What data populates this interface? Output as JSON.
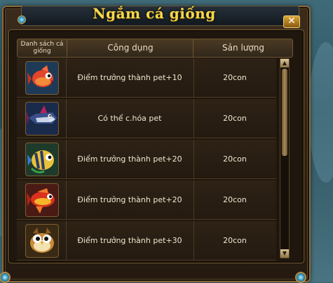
{
  "window": {
    "title": "Ngắm cá giống",
    "close_label": "✕"
  },
  "table": {
    "headers": {
      "list": "Danh sách cá giống",
      "use": "Công dụng",
      "qty": "Sản lượng"
    },
    "rows": [
      {
        "icon": "red-fish-icon",
        "use": "Điểm trưởng thành pet+10",
        "qty": "20con"
      },
      {
        "icon": "shark-fish-icon",
        "use": "Có thể c.hóa pet",
        "qty": "20con"
      },
      {
        "icon": "yellow-blue-fish-icon",
        "use": "Điểm trưởng thành pet+20",
        "qty": "20con"
      },
      {
        "icon": "red-gold-fish-icon",
        "use": "Điểm trưởng thành pet+20",
        "qty": "20con"
      },
      {
        "icon": "owl-fish-icon",
        "use": "Điểm trưởng thành pet+30",
        "qty": "20con"
      }
    ]
  },
  "scrollbar": {
    "up_label": "▲",
    "down_label": "▼"
  },
  "colors": {
    "title": "#f6d84a",
    "frame": "#8a6a3a",
    "text": "#f0e6cf"
  }
}
